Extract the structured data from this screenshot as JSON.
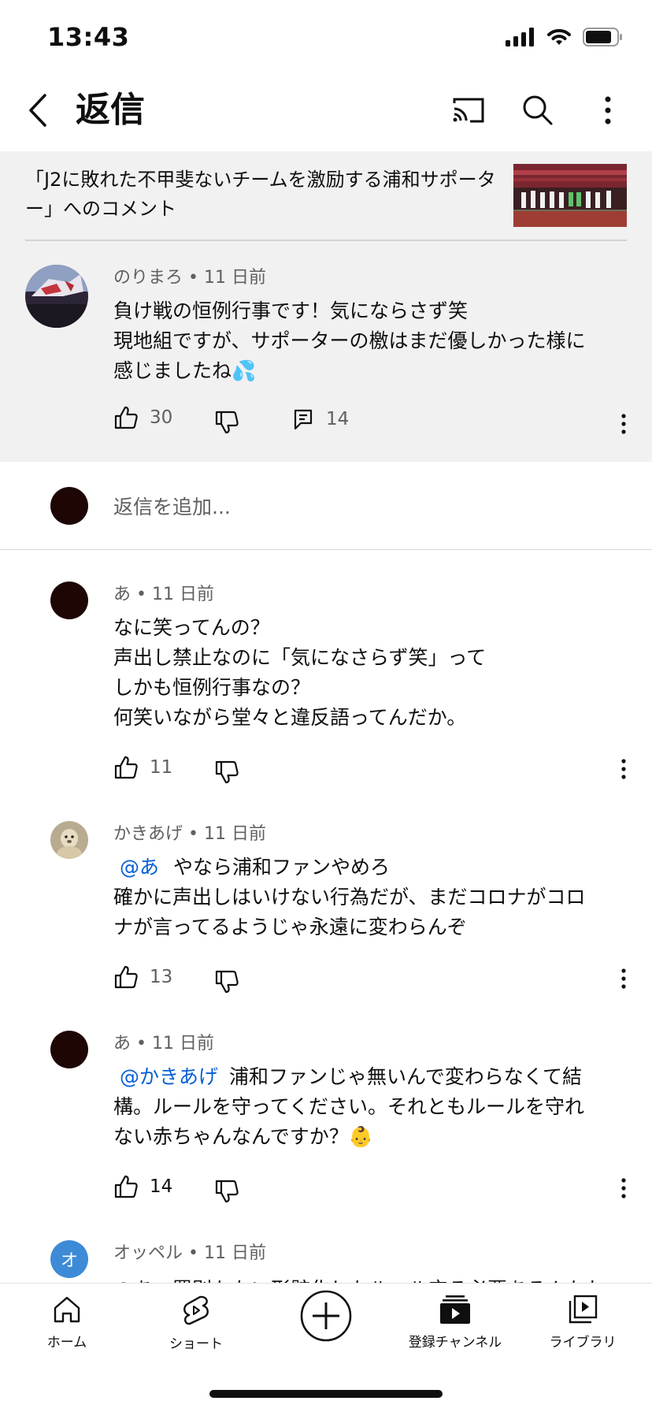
{
  "status": {
    "time": "13:43"
  },
  "header": {
    "title": "返信"
  },
  "video": {
    "comment_on": "「J2に敗れた不甲斐ないチームを激励する浦和サポーター」へのコメント"
  },
  "parent_comment": {
    "author": "のりまろ",
    "age": "11 日前",
    "lines": [
      "負け戦の恒例行事です！気にならさず笑",
      "現地組ですが、サポーターの檄はまだ優しかった様に",
      "感じましたね💦"
    ],
    "likes": "30",
    "replies": "14"
  },
  "add_reply": {
    "placeholder": "返信を追加..."
  },
  "replies": [
    {
      "author": "あ",
      "age": "11 日前",
      "lines": [
        "なに笑ってんの？",
        "声出し禁止なのに「気になさらず笑」って",
        "しかも恒例行事なの？",
        "何笑いながら堂々と違反語ってんだか。"
      ],
      "likes": "11"
    },
    {
      "author": "かきあげ",
      "age": "11 日前",
      "mention": "@あ",
      "first_line_rest": "やなら浦和ファンやめろ",
      "lines": [
        "確かに声出しはいけない行為だが、まだコロナがコロ",
        "ナが言ってるようじゃ永遠に変わらんぞ"
      ],
      "likes": "13"
    },
    {
      "author": "あ",
      "age": "11 日前",
      "mention": "@かきあげ",
      "first_line_rest": "浦和ファンじゃ無いんで変わらなくて結",
      "lines": [
        "構。ルールを守ってください。それともルールを守れ",
        "ない赤ちゃんなんですか？👶"
      ],
      "likes": "14"
    },
    {
      "author": "オッペル",
      "age": "11 日前",
      "avatar_letter": "オ",
      "partial_text": "@あ　罰則もない形骸化したルール守る必要あるんかね"
    }
  ],
  "nav": {
    "home": "ホーム",
    "shorts": "ショート",
    "subscriptions": "登録チャンネル",
    "library": "ライブラリ"
  },
  "colors": {
    "accent_link": "#065fd4",
    "avatar_blue": "#3d8bd6"
  }
}
